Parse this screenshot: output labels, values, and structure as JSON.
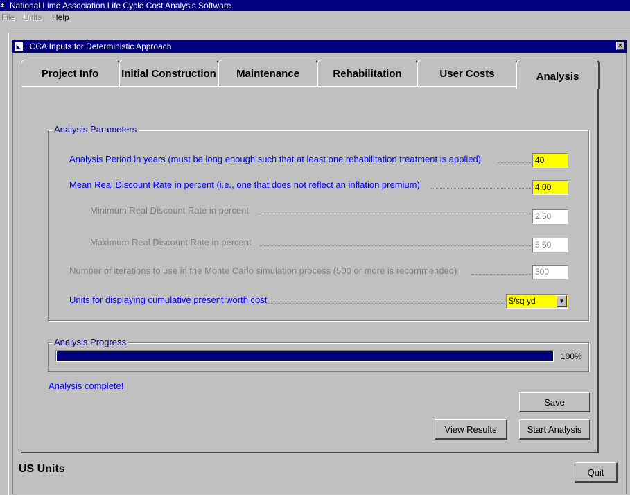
{
  "app": {
    "title": "National Lime Association Life Cycle Cost Analysis Software",
    "icon_name": "app-icon"
  },
  "menu": {
    "items": [
      {
        "label": "File",
        "enabled": false
      },
      {
        "label": "Units",
        "enabled": false
      },
      {
        "label": "Help",
        "enabled": true
      }
    ]
  },
  "window": {
    "title": "LCCA Inputs for Deterministic Approach",
    "close_label": "×"
  },
  "tabs": [
    {
      "label": "Project Info",
      "active": false
    },
    {
      "label": "Initial Construction",
      "active": false
    },
    {
      "label": "Maintenance",
      "active": false
    },
    {
      "label": "Rehabilitation",
      "active": false
    },
    {
      "label": "User Costs",
      "active": false
    },
    {
      "label": "Analysis",
      "active": true
    }
  ],
  "analysis_parameters": {
    "group_label": "Analysis Parameters",
    "analysis_period": {
      "label": "Analysis Period in years (must be long enough such that at least one rehabilitation treatment is applied)",
      "value": "40"
    },
    "mean_discount": {
      "label": "Mean Real Discount Rate in percent (i.e., one that does not reflect an inflation premium)",
      "value": "4.00"
    },
    "min_discount": {
      "label": "Minimum Real Discount Rate in percent",
      "value": "2.50"
    },
    "max_discount": {
      "label": "Maximum Real Discount Rate in percent",
      "value": "5.50"
    },
    "iterations": {
      "label": "Number of iterations to use in the Monte Carlo simulation process (500 or more is recommended)",
      "value": "500"
    },
    "display_units": {
      "label": "Units for displaying cumulative present worth cost",
      "value": "$/sq yd"
    }
  },
  "analysis_progress": {
    "group_label": "Analysis Progress",
    "percent": 100,
    "percent_label": "100%"
  },
  "status": {
    "message": "Analysis complete!"
  },
  "buttons": {
    "save": "Save",
    "view_results": "View Results",
    "start_analysis": "Start Analysis",
    "quit": "Quit"
  },
  "footer": {
    "units": "US Units"
  },
  "colors": {
    "title_bar": "#000080",
    "highlight_field": "#ffff00",
    "label_blue": "#0000ff",
    "progress_fill": "#000080"
  }
}
